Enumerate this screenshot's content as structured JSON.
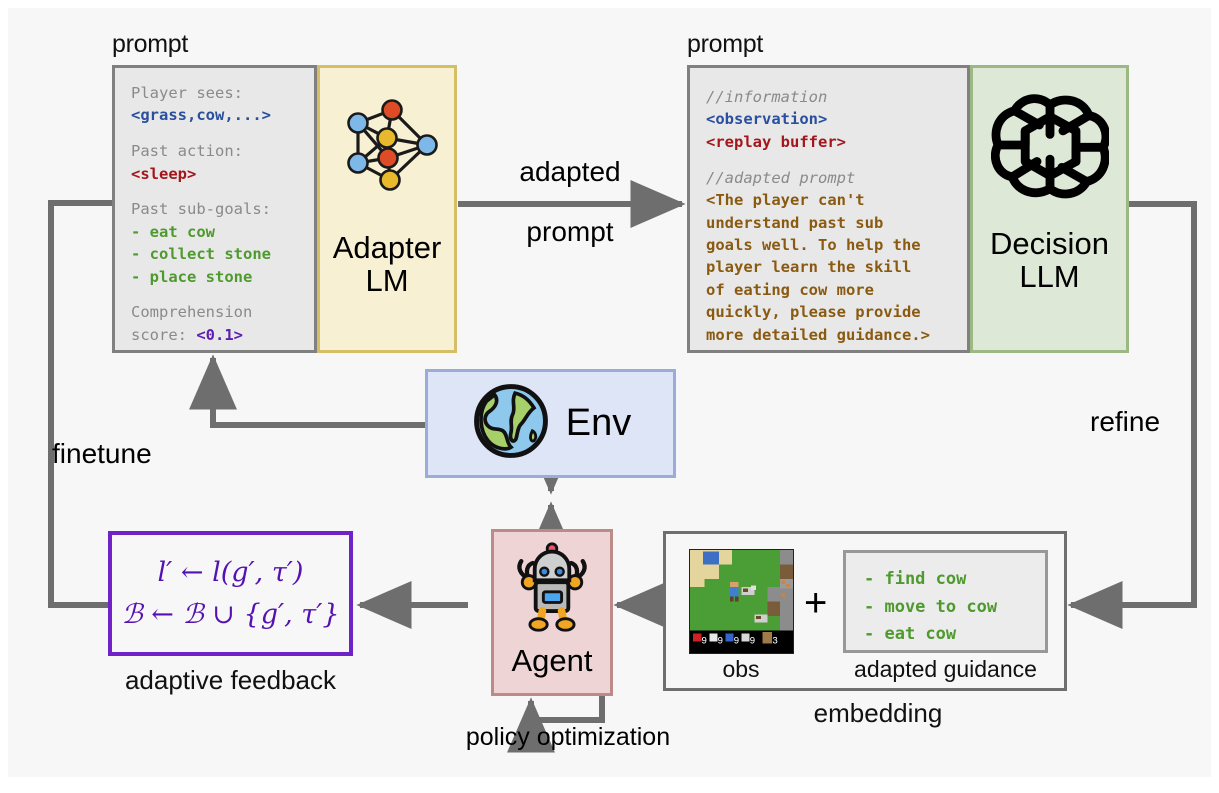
{
  "title": "Adaptive prompting loop with Adapter LM, Decision LLM and Agent",
  "left_prompt": {
    "label": "prompt",
    "lines": [
      {
        "text": "Player sees:",
        "style": "grey"
      },
      {
        "text": "<grass,cow,...>",
        "style": "blue"
      },
      {
        "text": "",
        "style": "blank"
      },
      {
        "text": "Past action:",
        "style": "grey"
      },
      {
        "text": "<sleep>",
        "style": "red"
      },
      {
        "text": "",
        "style": "blank"
      },
      {
        "text": "Past sub-goals:",
        "style": "grey"
      },
      {
        "text": "- eat cow",
        "style": "green"
      },
      {
        "text": "- collect stone",
        "style": "green"
      },
      {
        "text": "- place stone",
        "style": "green"
      },
      {
        "text": "",
        "style": "blank"
      },
      {
        "text": "Comprehension",
        "style": "grey"
      },
      {
        "text": "score: ",
        "style": "grey",
        "tail": "<0.1>",
        "tail_style": "purple"
      }
    ]
  },
  "adapter": {
    "title_line1": "Adapter",
    "title_line2": "LM",
    "icon": "neural-network-icon",
    "fill": "#f8f0d3",
    "border": "#d5bf66"
  },
  "adapted_prompt_arrow": {
    "label_line1": "adapted",
    "label_line2": "prompt"
  },
  "right_prompt": {
    "label": "prompt",
    "lines": [
      {
        "text": "//information",
        "style": "ital"
      },
      {
        "text": "<observation>",
        "style": "blue"
      },
      {
        "text": "<replay buffer>",
        "style": "red"
      },
      {
        "text": "",
        "style": "blank"
      },
      {
        "text": "//adapted prompt",
        "style": "ital"
      },
      {
        "text": "<The player can't",
        "style": "brown"
      },
      {
        "text": "understand past sub",
        "style": "brown"
      },
      {
        "text": "goals well. To help the",
        "style": "brown"
      },
      {
        "text": "player learn the skill",
        "style": "brown"
      },
      {
        "text": "of eating cow more",
        "style": "brown"
      },
      {
        "text": "quickly, please provide",
        "style": "brown"
      },
      {
        "text": "more detailed guidance.>",
        "style": "brown"
      }
    ]
  },
  "decision": {
    "title_line1": "Decision",
    "title_line2": "LLM",
    "icon": "openai-knot-icon",
    "fill": "#dde8d7",
    "border": "#9cb984"
  },
  "env": {
    "title": "Env",
    "icon": "globe-icon",
    "fill": "#dee5f6",
    "border": "#9aadd8"
  },
  "agent": {
    "title": "Agent",
    "icon": "robot-icon",
    "fill": "#eed4d4",
    "border": "#bd8a8a"
  },
  "feedback": {
    "formula_line1": "l′ ← l(g′, τ′)",
    "formula_line2": "ℬ ← ℬ ∪ {g′, τ′}",
    "caption": "adaptive feedback",
    "border": "#6f22c7"
  },
  "embedding": {
    "caption": "embedding",
    "obs_caption": "obs",
    "plus": "+",
    "guidance_caption": "adapted guidance",
    "guidance_lines": [
      "- find cow",
      "- move to cow",
      "- eat cow"
    ]
  },
  "arrows": {
    "finetune": "finetune",
    "refine": "refine",
    "policy_optimization": "policy optimization"
  },
  "colors": {
    "arrow": "#6e6e6e",
    "code_bg": "#e8e8e8",
    "code_border": "#808080",
    "canvas": "#f7f7f7"
  }
}
